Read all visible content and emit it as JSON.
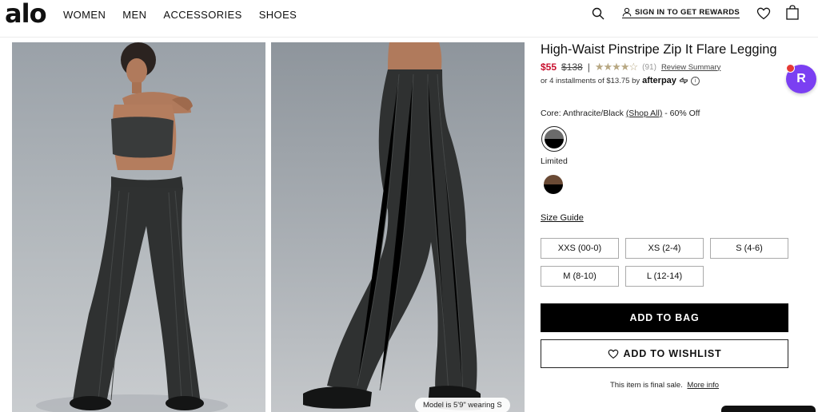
{
  "header": {
    "logo": "alo",
    "nav": [
      "WOMEN",
      "MEN",
      "ACCESSORIES",
      "SHOES"
    ],
    "signin": "SIGN IN TO GET REWARDS"
  },
  "images": {
    "caption": "Model is 5'9\" wearing S"
  },
  "product": {
    "title": "High-Waist Pinstripe Zip It Flare Legging",
    "sale_price": "$55",
    "original_price": "$138",
    "separator": "|",
    "stars": "★★★★☆",
    "rating_fraction": 0.7,
    "review_count": "(91)",
    "review_summary": "Review Summary",
    "installments": "or 4 installments of $13.75 by",
    "afterpay": "afterpay",
    "info": "i",
    "color_prefix": "Core: Anthracite/Black",
    "shop_all": "(Shop All)",
    "color_suffix": "- 60% Off",
    "limited": "Limited",
    "size_guide": "Size Guide",
    "sizes": [
      "XXS (00-0)",
      "XS (2-4)",
      "S (4-6)",
      "M (8-10)",
      "L (12-14)"
    ],
    "add_to_bag": "ADD TO BAG",
    "add_to_wishlist": "ADD TO WISHLIST",
    "final_sale": "This item is final sale.",
    "more_info": "More info"
  },
  "widgets": {
    "rewards_letter": "R"
  },
  "colors": {
    "sale": "#c8102e",
    "rewards": "#7b3ff2",
    "primary_button": "#000000"
  }
}
